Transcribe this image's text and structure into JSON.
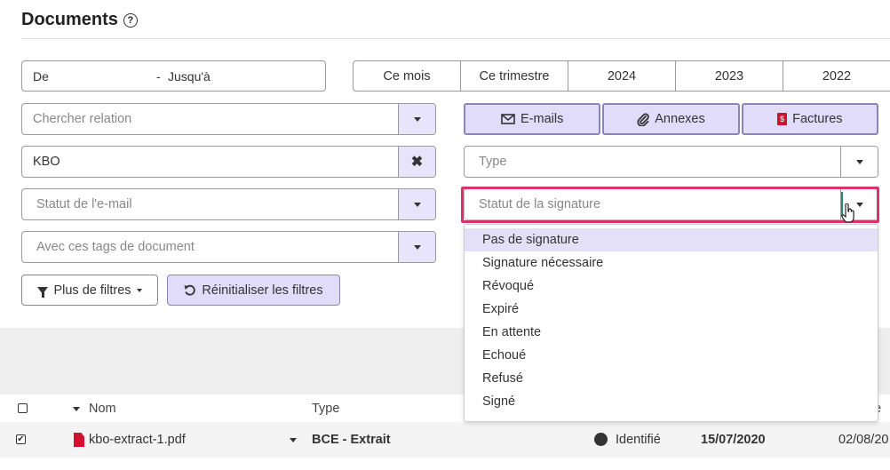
{
  "header": {
    "title": "Documents",
    "help_glyph": "?"
  },
  "date_range": {
    "from_placeholder": "De",
    "separator": "-",
    "to_placeholder": "Jusqu'à"
  },
  "periods": [
    "Ce mois",
    "Ce trimestre",
    "2024",
    "2023",
    "2022"
  ],
  "filters": {
    "relation_placeholder": "Chercher relation",
    "kbo_value": "KBO",
    "clear_glyph": "✖",
    "email_status_placeholder": "Statut de l'e-mail",
    "doc_tags_placeholder": "Avec ces tags de document",
    "type_placeholder": "Type",
    "signature_status_placeholder": "Statut de la signature"
  },
  "kinds": [
    {
      "label": "E-mails",
      "icon": "envelope-icon"
    },
    {
      "label": "Annexes",
      "icon": "paperclip-icon"
    },
    {
      "label": "Factures",
      "icon": "invoice-icon"
    }
  ],
  "buttons": {
    "more_filters": "Plus de filtres",
    "reset_filters": "Réinitialiser les filtres"
  },
  "signature_options": [
    "Pas de signature",
    "Signature nécessaire",
    "Révoqué",
    "Expiré",
    "En attente",
    "Echoué",
    "Refusé",
    "Signé"
  ],
  "table": {
    "columns": {
      "name": "Nom",
      "type": "Type",
      "partial_right": "e"
    },
    "rows": [
      {
        "checked": "✔",
        "name": "kbo-extract-1.pdf",
        "type": "BCE - Extrait",
        "status": "Identifié",
        "date1": "15/07/2020",
        "date2": "02/08/20"
      }
    ]
  },
  "colors": {
    "accent_bg": "#e0dcfa",
    "highlight": "#d9336a",
    "pdf_red": "#d0102e"
  }
}
